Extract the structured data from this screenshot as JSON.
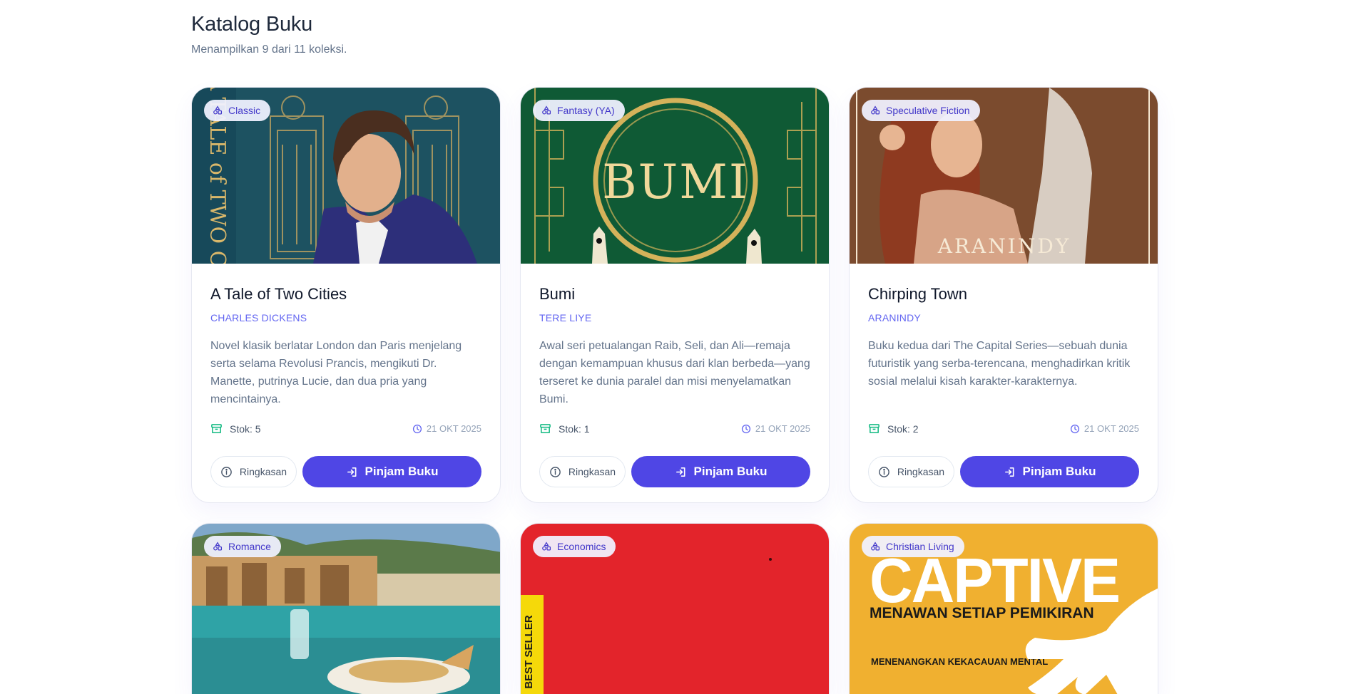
{
  "header": {
    "title": "Katalog Buku",
    "subtitle": "Menampilkan 9 dari 11 koleksi."
  },
  "books": [
    {
      "category": "Classic",
      "title": "A Tale of Two Cities",
      "author": "CHARLES DICKENS",
      "description": "Novel klasik berlatar London dan Paris menjelang serta selama Revolusi Prancis, mengikuti Dr. Manette, putrinya Lucie, dan dua pria yang mencintainya.",
      "stock_label": "Stok: 5",
      "date": "21 OKT 2025",
      "summary_label": "Ringkasan",
      "borrow_label": "Pinjam Buku",
      "cover_spine_text": "A TALE of TWO CITIES"
    },
    {
      "category": "Fantasy (YA)",
      "title": "Bumi",
      "author": "TERE LIYE",
      "description": "Awal seri petualangan Raib, Seli, dan Ali—remaja dengan kemampuan khusus dari klan berbeda—yang terseret ke dunia paralel dan misi menyelamatkan Bumi.",
      "stock_label": "Stok: 1",
      "date": "21 OKT 2025",
      "summary_label": "Ringkasan",
      "borrow_label": "Pinjam Buku",
      "cover_text": "BUMI"
    },
    {
      "category": "Speculative Fiction",
      "title": "Chirping Town",
      "author": "ARANINDY",
      "description": "Buku kedua dari The Capital Series—sebuah dunia futuristik yang serba-terencana, menghadirkan kritik sosial melalui kisah karakter-karakternya.",
      "stock_label": "Stok: 2",
      "date": "21 OKT 2025",
      "summary_label": "Ringkasan",
      "borrow_label": "Pinjam Buku",
      "cover_text": "ARANINDY"
    },
    {
      "category": "Romance"
    },
    {
      "category": "Economics",
      "cover_text": "BEST SELLER"
    },
    {
      "category": "Christian Living",
      "cover_title": "CAPTIVE",
      "cover_subtitle": "MENAWAN SETIAP PEMIKIRAN",
      "cover_tagline": "MENENANGKAN KEKACAUAN MENTAL"
    }
  ],
  "colors": {
    "accent": "#4f46e5",
    "author": "#6366f1",
    "stock_icon": "#10b981"
  },
  "icons": {
    "badge": "shapes-icon",
    "stock": "archive-box-icon",
    "date": "clock-icon",
    "summary": "info-circle-icon",
    "borrow": "login-arrow-icon"
  }
}
